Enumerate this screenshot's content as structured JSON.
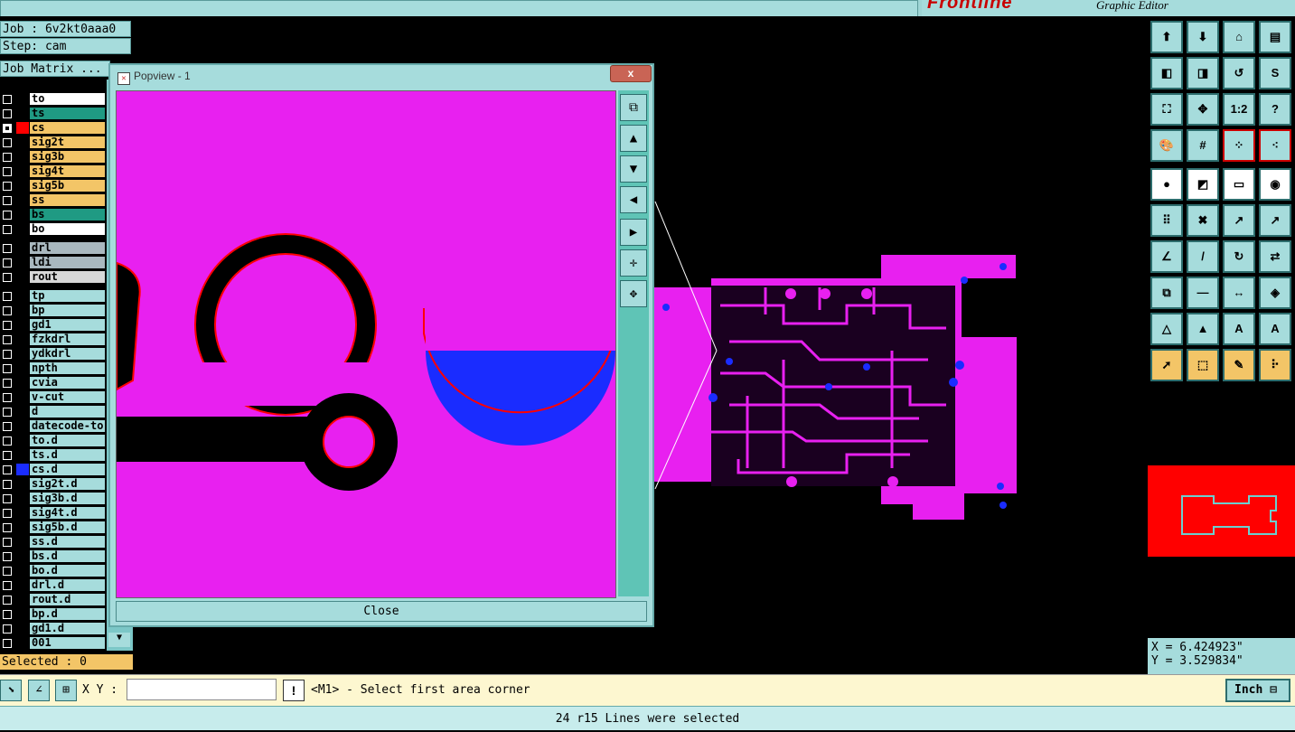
{
  "app": {
    "brand": "Frontline",
    "subtitle": "Graphic Editor"
  },
  "job": {
    "job_label": "Job : 6v2kt0aaa0",
    "step_label": "Step: cam",
    "matrix_label": "Job Matrix ..."
  },
  "layers": [
    {
      "name": "to",
      "bg": "#ffffff",
      "color": "",
      "checked": false
    },
    {
      "name": "ts",
      "bg": "#1f9a83",
      "color": "",
      "checked": false
    },
    {
      "name": "cs",
      "bg": "#f3c567",
      "color": "#ff0000",
      "checked": true
    },
    {
      "name": "sig2t",
      "bg": "#f3c567",
      "color": "",
      "checked": false
    },
    {
      "name": "sig3b",
      "bg": "#f3c567",
      "color": "",
      "checked": false
    },
    {
      "name": "sig4t",
      "bg": "#f3c567",
      "color": "",
      "checked": false
    },
    {
      "name": "sig5b",
      "bg": "#f3c567",
      "color": "",
      "checked": false
    },
    {
      "name": "ss",
      "bg": "#f3c567",
      "color": "",
      "checked": false
    },
    {
      "name": "bs",
      "bg": "#1f9a83",
      "color": "",
      "checked": false
    },
    {
      "name": "bo",
      "bg": "#ffffff",
      "color": "",
      "checked": false
    }
  ],
  "layers_drill": [
    {
      "name": "drl",
      "bg": "#a9b8bf"
    },
    {
      "name": "ldi",
      "bg": "#a9b8bf"
    },
    {
      "name": "rout",
      "bg": "#d8d8d8"
    }
  ],
  "layers_misc": [
    {
      "name": "tp",
      "color": ""
    },
    {
      "name": "bp",
      "color": ""
    },
    {
      "name": "gd1",
      "color": ""
    },
    {
      "name": "fzkdrl",
      "color": ""
    },
    {
      "name": "ydkdrl",
      "color": ""
    },
    {
      "name": "npth",
      "color": ""
    },
    {
      "name": "cvia",
      "color": ""
    },
    {
      "name": "v-cut",
      "color": ""
    },
    {
      "name": "d",
      "color": ""
    },
    {
      "name": "datecode-to",
      "color": ""
    },
    {
      "name": "to.d",
      "color": ""
    },
    {
      "name": "ts.d",
      "color": ""
    },
    {
      "name": "cs.d",
      "color": "#1a2cff"
    },
    {
      "name": "sig2t.d",
      "color": ""
    },
    {
      "name": "sig3b.d",
      "color": ""
    },
    {
      "name": "sig4t.d",
      "color": ""
    },
    {
      "name": "sig5b.d",
      "color": ""
    },
    {
      "name": "ss.d",
      "color": ""
    },
    {
      "name": "bs.d",
      "color": ""
    },
    {
      "name": "bo.d",
      "color": ""
    },
    {
      "name": "drl.d",
      "color": ""
    },
    {
      "name": "rout.d",
      "color": ""
    },
    {
      "name": "bp.d",
      "color": ""
    },
    {
      "name": "gd1.d",
      "color": ""
    },
    {
      "name": "001",
      "color": ""
    }
  ],
  "selected_label": "Selected : 0",
  "popup": {
    "title": "Popview - 1",
    "close_x": "x",
    "close_label": "Close"
  },
  "coords": {
    "x": "X = 6.424923\"",
    "y": "Y = 3.529834\""
  },
  "command": {
    "xy_label": "X Y :",
    "xy_value": "",
    "prompt": "<M1> - Select first area corner",
    "unit": "Inch"
  },
  "status": "24 r15 Lines were selected",
  "colors": {
    "cs_layer": "#ff0000",
    "board_magenta": "#e820f0",
    "highlight_blue": "#1a2cff",
    "panel_teal": "#a6dcdc"
  }
}
